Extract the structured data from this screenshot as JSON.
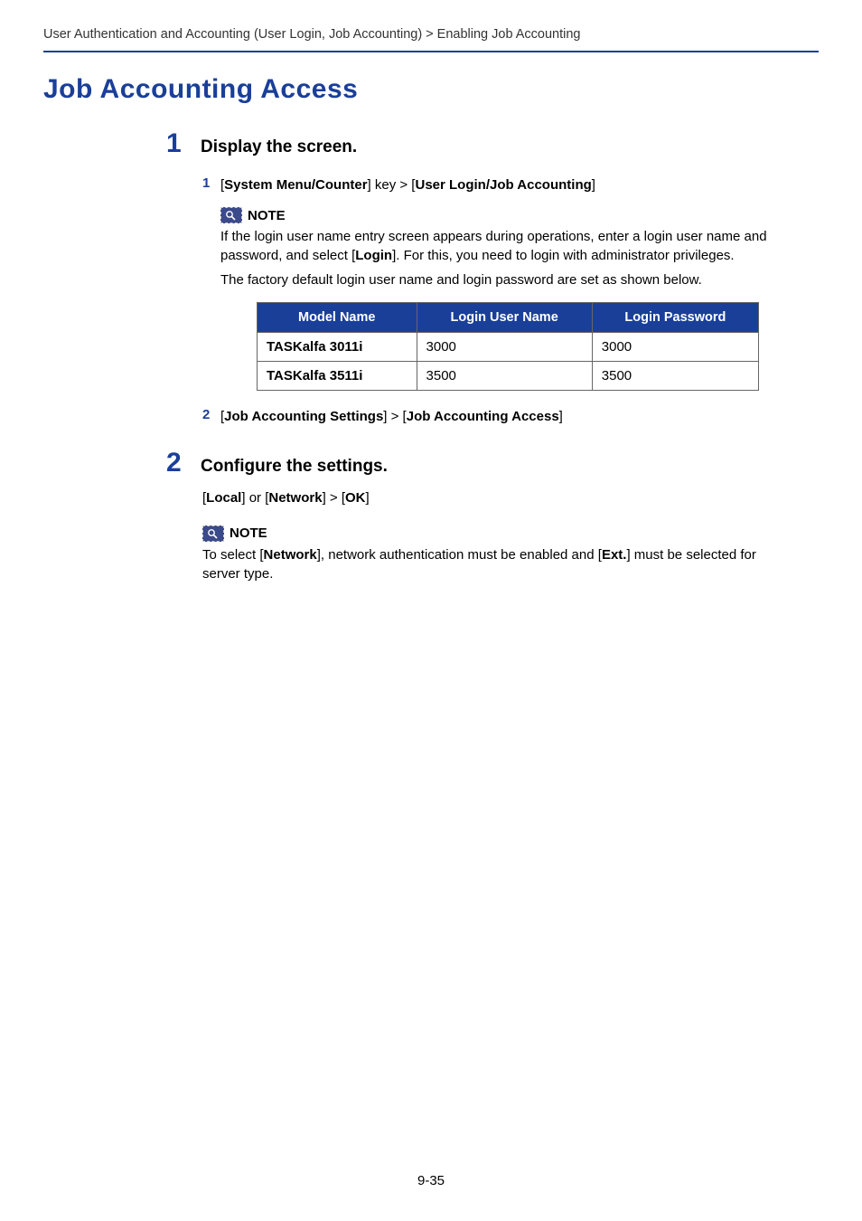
{
  "breadcrumb": "User Authentication and Accounting (User Login, Job Accounting) > Enabling Job Accounting",
  "title": "Job Accounting Access",
  "step1": {
    "num": "1",
    "heading": "Display the screen.",
    "sub1": {
      "num": "1",
      "open_bracket": "[",
      "bold1": "System Menu/Counter",
      "mid1": "] key > [",
      "bold2": "User Login/Job Accounting",
      "close": "]"
    },
    "note": {
      "label": "NOTE",
      "line1a": "If the login user name entry screen appears during operations, enter a login user name and password, and select [",
      "line1b": "Login",
      "line1c": "]. For this, you need to login with administrator privileges.",
      "line2": "The factory default login user name and login password are set as shown below."
    },
    "table": {
      "headers": [
        "Model Name",
        "Login User Name",
        "Login Password"
      ],
      "rows": [
        [
          "TASKalfa 3011i",
          "3000",
          "3000"
        ],
        [
          "TASKalfa 3511i",
          "3500",
          "3500"
        ]
      ]
    },
    "sub2": {
      "num": "2",
      "open": "[",
      "bold1": "Job Accounting Settings",
      "mid": "] > [",
      "bold2": "Job Accounting Access",
      "close": "]"
    }
  },
  "step2": {
    "num": "2",
    "heading": "Configure the settings.",
    "line": {
      "open": "[",
      "b1": "Local",
      "mid1": "] or [",
      "b2": "Network",
      "mid2": "] > [",
      "b3": "OK",
      "close": "]"
    },
    "note": {
      "label": "NOTE",
      "t1": "To select [",
      "b1": "Network",
      "t2": "], network authentication must be enabled and [",
      "b2": "Ext.",
      "t3": "] must be selected for server type."
    }
  },
  "footer": "9-35"
}
